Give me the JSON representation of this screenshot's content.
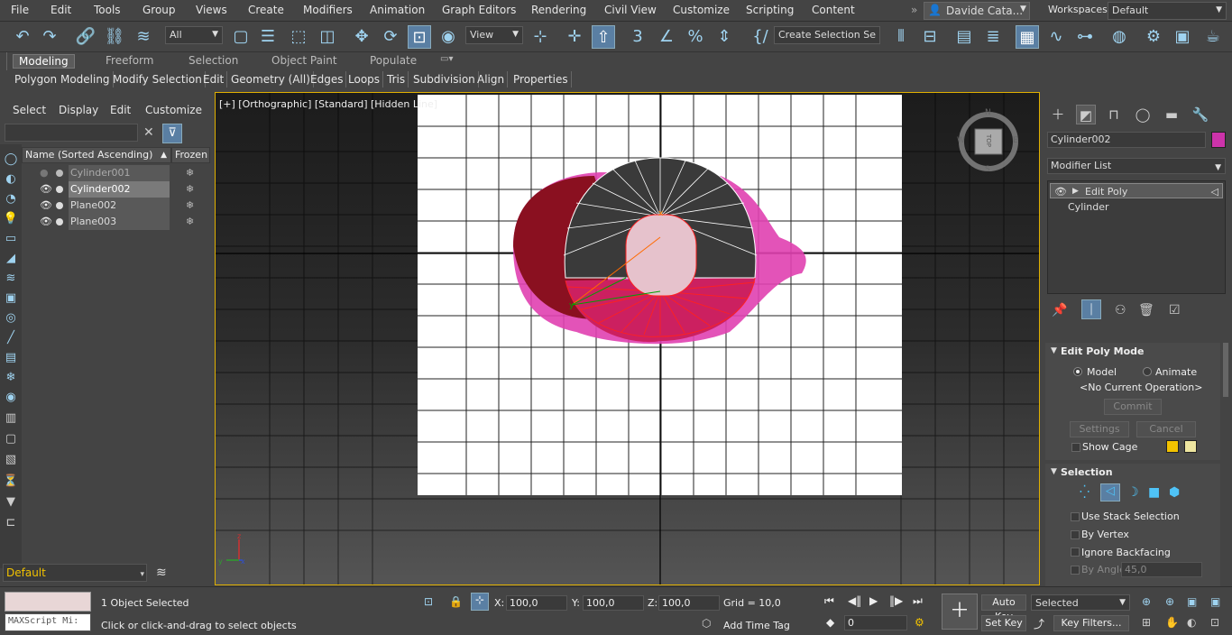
{
  "menubar": {
    "items": [
      "File",
      "Edit",
      "Tools",
      "Group",
      "Views",
      "Create",
      "Modifiers",
      "Animation",
      "Graph Editors",
      "Rendering",
      "Civil View",
      "Customize",
      "Scripting",
      "Content"
    ],
    "user": "Davide Cata...",
    "workspaces_label": "Workspaces:",
    "workspace": "Default"
  },
  "toolbar": {
    "selection_filter": "All",
    "ref_coord": "View",
    "named_selection": "Create Selection Se"
  },
  "ribbon": {
    "tabs": [
      "Modeling",
      "Freeform",
      "Selection",
      "Object Paint",
      "Populate"
    ],
    "active": "Modeling",
    "sub": [
      "Polygon Modeling",
      "Modify Selection",
      "Edit",
      "Geometry (All)",
      "Edges",
      "Loops",
      "Tris",
      "Subdivision",
      "Align",
      "Properties"
    ]
  },
  "scene_explorer": {
    "menus": [
      "Select",
      "Display",
      "Edit",
      "Customize"
    ],
    "col_name": "Name (Sorted Ascending)",
    "col_frozen": "Frozen",
    "rows": [
      {
        "name": "Cylinder001",
        "hidden": true
      },
      {
        "name": "Cylinder002",
        "selected": true
      },
      {
        "name": "Plane002"
      },
      {
        "name": "Plane003"
      }
    ],
    "layer": "Default"
  },
  "viewport": {
    "label": "[+] [Orthographic] [Standard] [Hidden Line]",
    "viewcube_label": "TOP",
    "compass": {
      "n": "N",
      "e": "E",
      "s": "S",
      "w": "W"
    }
  },
  "command_panel": {
    "object_name": "Cylinder002",
    "object_color": "#cc33aa",
    "modifier_list": "Modifier List",
    "stack": [
      "Edit Poly",
      "Cylinder"
    ],
    "edit_poly_mode": {
      "title": "Edit Poly Mode",
      "model": "Model",
      "animate": "Animate",
      "operation": "<No Current Operation>",
      "commit": "Commit",
      "settings": "Settings",
      "cancel": "Cancel",
      "show_cage": "Show Cage",
      "cage_colors": [
        "#f2c200",
        "#eee6a0"
      ]
    },
    "selection": {
      "title": "Selection",
      "use_stack": "Use Stack Selection",
      "by_vertex": "By Vertex",
      "ignore_backfacing": "Ignore Backfacing",
      "by_angle": "By Angle:",
      "angle_value": "45,0"
    }
  },
  "status": {
    "maxscript": "MAXScript Mi:",
    "objects_selected": "1 Object Selected",
    "prompt": "Click or click-and-drag to select objects",
    "x_label": "X:",
    "x": "100,0",
    "y_label": "Y:",
    "y": "100,0",
    "z_label": "Z:",
    "z": "100,0",
    "grid": "Grid = 10,0",
    "add_time_tag": "Add Time Tag",
    "auto_key": "Auto Key",
    "set_key": "Set Key",
    "key_mode": "Selected",
    "key_filters": "Key Filters...",
    "frame": "0"
  }
}
